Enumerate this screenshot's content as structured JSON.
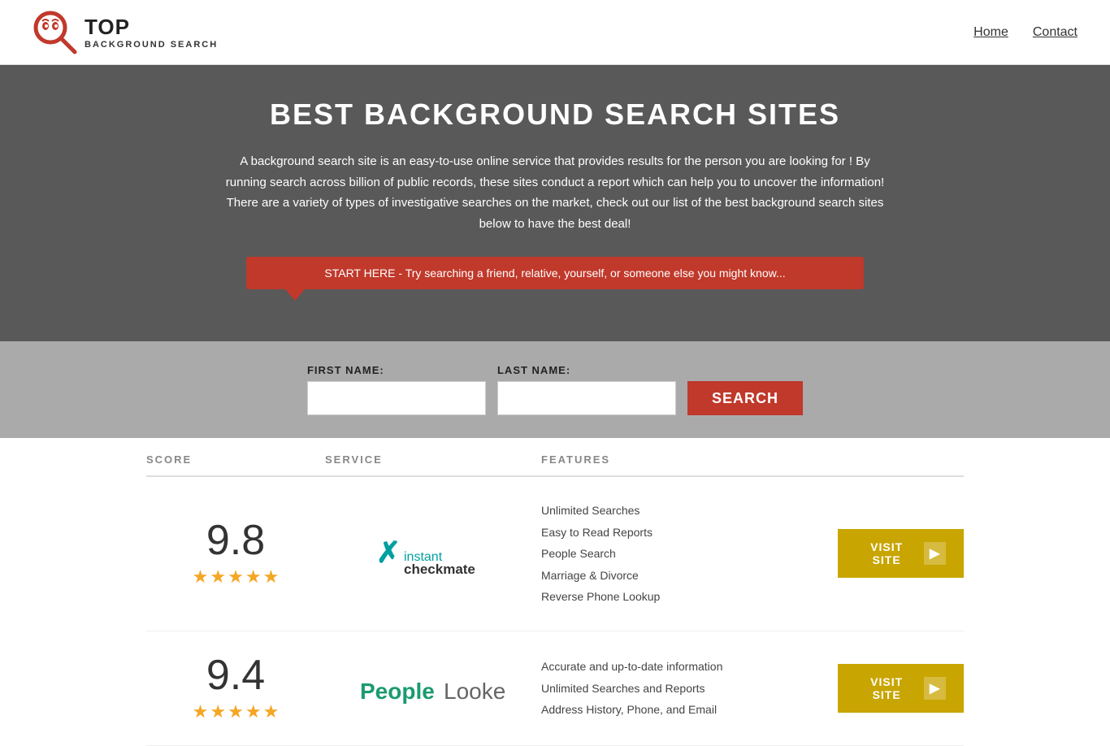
{
  "header": {
    "logo_top": "TOP",
    "logo_sub": "BACKGROUND SEARCH",
    "nav": [
      {
        "label": "Home",
        "id": "nav-home"
      },
      {
        "label": "Contact",
        "id": "nav-contact"
      }
    ]
  },
  "hero": {
    "title": "BEST BACKGROUND SEARCH SITES",
    "description": "A background search site is an easy-to-use online service that provides results  for the person you are looking for ! By  running  search across billion of public records, these sites conduct  a report which can help you to uncover the information! There are a variety of types of investigative searches on the market, check out our  list of the best background search sites below to have the best deal!",
    "callout": "START HERE - Try searching a friend, relative, yourself, or someone else you might know..."
  },
  "search_form": {
    "first_name_label": "FIRST NAME:",
    "last_name_label": "LAST NAME:",
    "button_label": "SEARCH",
    "first_name_placeholder": "",
    "last_name_placeholder": ""
  },
  "table": {
    "headers": {
      "score": "SCORE",
      "service": "SERVICE",
      "features": "FEATURES",
      "action": ""
    },
    "rows": [
      {
        "score": "9.8",
        "stars": 4.5,
        "service_name": "Instant Checkmate",
        "features": [
          "Unlimited Searches",
          "Easy to Read Reports",
          "People Search",
          "Marriage & Divorce",
          "Reverse Phone Lookup"
        ],
        "visit_label": "VISIT SITE",
        "score_color": "#333",
        "btn_color": "#c8a000"
      },
      {
        "score": "9.4",
        "stars": 4.5,
        "service_name": "PeopleLooker",
        "features": [
          "Accurate and up-to-date information",
          "Unlimited Searches and Reports",
          "Address History, Phone, and Email"
        ],
        "visit_label": "VISIT SITE",
        "score_color": "#333",
        "btn_color": "#c8a000"
      }
    ]
  }
}
